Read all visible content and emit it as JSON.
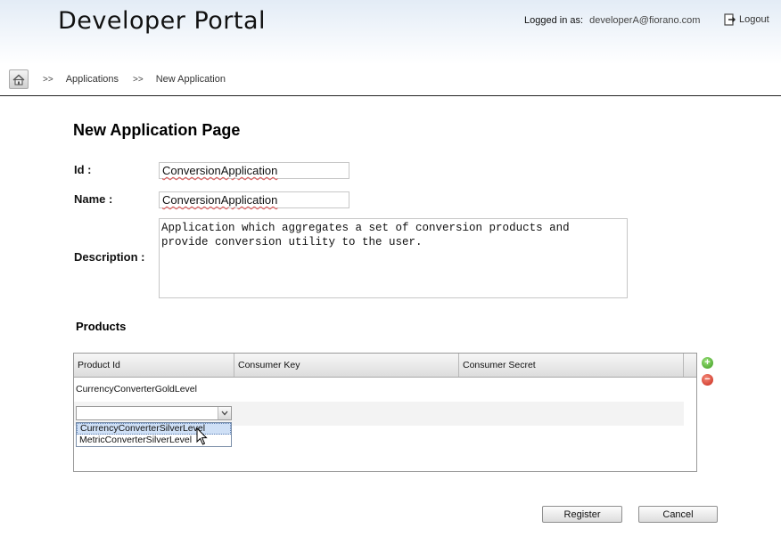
{
  "header": {
    "app_title": "Developer Portal",
    "logged_in_label": "Logged in as:",
    "username": "developerA@fiorano.com",
    "logout_label": "Logout"
  },
  "breadcrumb": {
    "separator": ">>",
    "items": [
      "Applications",
      "New Application"
    ]
  },
  "form": {
    "page_title": "New Application Page",
    "id_label": "Id :",
    "id_value": "ConversionApplication",
    "name_label": "Name :",
    "name_value": "ConversionApplication",
    "description_label": "Description :",
    "description_value": "Application which aggregates a set of conversion products and\nprovide conversion utility to the user."
  },
  "products": {
    "section_title": "Products",
    "columns": [
      "Product Id",
      "Consumer Key",
      "Consumer Secret"
    ],
    "rows": [
      {
        "product_id": "CurrencyConverterGoldLevel",
        "consumer_key": "",
        "consumer_secret": ""
      }
    ],
    "dropdown_selected": "",
    "dropdown_options": [
      "CurrencyConverterSilverLevel",
      "MetricConverterSilverLevel"
    ],
    "highlighted_option": "CurrencyConverterSilverLevel"
  },
  "actions": {
    "register_label": "Register",
    "cancel_label": "Cancel"
  },
  "colors": {
    "add": "#3b9a1e",
    "remove": "#c8281a",
    "highlight": "#cfe0f6"
  }
}
